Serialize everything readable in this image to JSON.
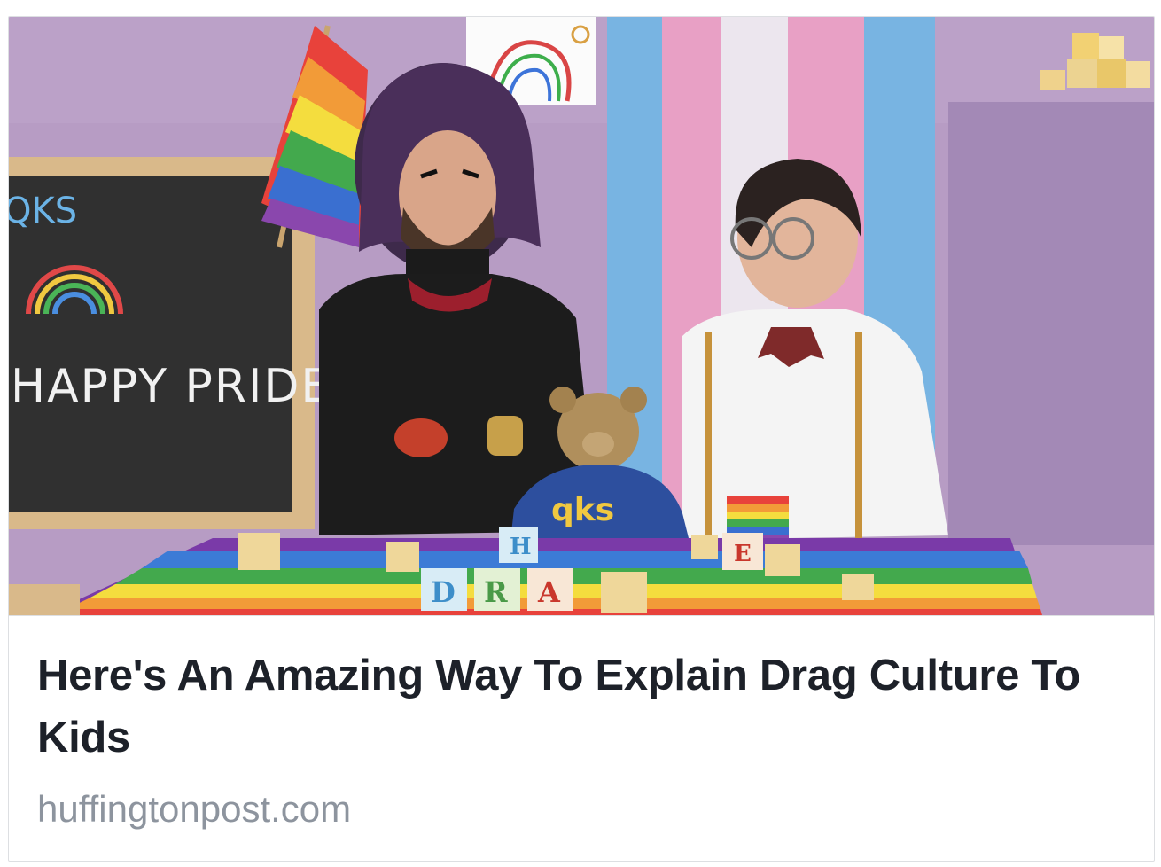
{
  "link_preview": {
    "headline": "Here's An Amazing Way To Explain Drag Culture To Kids",
    "domain": "huffingtonpost.com"
  },
  "thumbnail": {
    "chalkboard_text": {
      "logo": "QKS",
      "message": "HAPPY PRIDE!"
    },
    "sweater_text": "qks",
    "blocks": {
      "front": [
        "D",
        "R",
        "A"
      ],
      "back": [
        "H",
        "E"
      ]
    },
    "colors": {
      "wall": "#b89cc4",
      "chalkboard": "#2a2a2a",
      "frame": "#d9b98a",
      "trans_blue": "#79b6e3",
      "trans_pink": "#eaa0c6"
    }
  }
}
